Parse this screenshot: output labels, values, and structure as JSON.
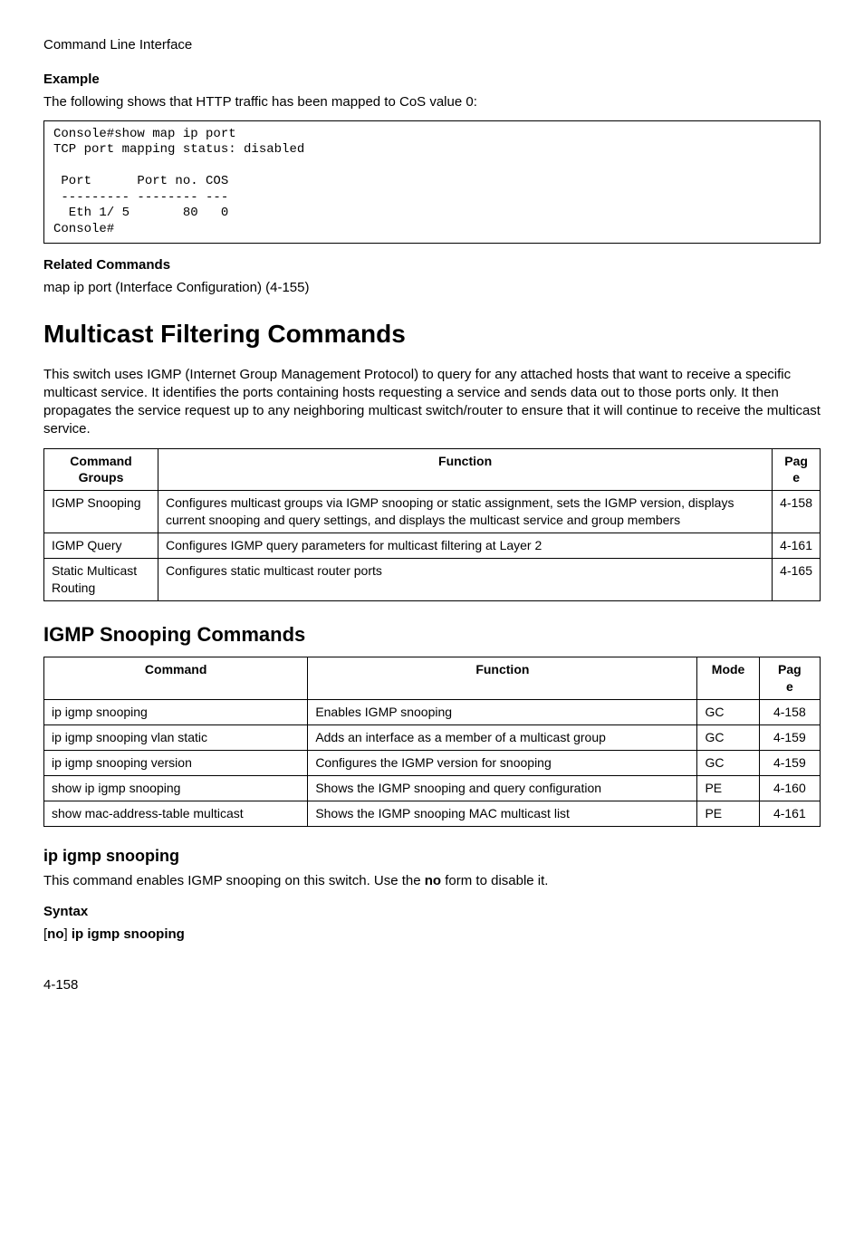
{
  "running_header": "Command Line Interface",
  "example": {
    "label": "Example",
    "text": "The following shows that HTTP traffic has been mapped to CoS value 0:",
    "code": "Console#show map ip port\nTCP port mapping status: disabled\n\n Port      Port no. COS\n --------- -------- ---\n  Eth 1/ 5       80   0\nConsole#"
  },
  "related": {
    "label": "Related Commands",
    "text": "map ip port (Interface Configuration) (4-155)"
  },
  "multicast": {
    "heading": "Multicast Filtering Commands",
    "intro": "This switch uses IGMP (Internet Group Management Protocol) to query for any attached hosts that want to receive a specific multicast service. It identifies the ports containing hosts requesting a service and sends data out to those ports only. It then propagates the service request up to any neighboring multicast switch/router to ensure that it will continue to receive the multicast service.",
    "table": {
      "headers": {
        "c1": "Command Groups",
        "c2": "Function",
        "c3": "Pag\ne"
      },
      "rows": [
        {
          "c1": "IGMP Snooping",
          "c2": "Configures multicast groups via IGMP snooping or static assignment, sets the IGMP version, displays current snooping and query settings, and displays the multicast service and group members",
          "c3": "4-158"
        },
        {
          "c1": "IGMP Query",
          "c2": "Configures IGMP query parameters for multicast filtering at Layer 2",
          "c3": "4-161"
        },
        {
          "c1": "Static Multicast Routing",
          "c2": "Configures static multicast router ports",
          "c3": "4-165"
        }
      ]
    }
  },
  "snooping": {
    "heading": "IGMP Snooping Commands",
    "table": {
      "headers": {
        "c1": "Command",
        "c2": "Function",
        "c3": "Mode",
        "c4": "Pag\ne"
      },
      "rows": [
        {
          "c1": "ip igmp snooping",
          "c2": "Enables IGMP snooping",
          "c3": "GC",
          "c4": "4-158"
        },
        {
          "c1": "ip igmp snooping vlan static",
          "c2": "Adds an interface as a member of a multicast group",
          "c3": "GC",
          "c4": "4-159"
        },
        {
          "c1": "ip igmp snooping version",
          "c2": "Configures the IGMP version for snooping",
          "c3": "GC",
          "c4": "4-159"
        },
        {
          "c1": "show ip igmp snooping",
          "c2": "Shows the IGMP snooping and query configuration",
          "c3": "PE",
          "c4": "4-160"
        },
        {
          "c1": "show mac-address-table multicast",
          "c2": "Shows the IGMP snooping MAC multicast list",
          "c3": "PE",
          "c4": "4-161"
        }
      ]
    }
  },
  "ip_igmp": {
    "heading": "ip igmp snooping",
    "desc_prefix": "This command enables IGMP snooping on this switch. Use the ",
    "desc_bold": "no",
    "desc_suffix": " form to disable it.",
    "syntax_label": "Syntax",
    "syntax_open": "[",
    "syntax_no": "no",
    "syntax_close": "] ",
    "syntax_cmd": "ip igmp snooping"
  },
  "page_number": "4-158"
}
